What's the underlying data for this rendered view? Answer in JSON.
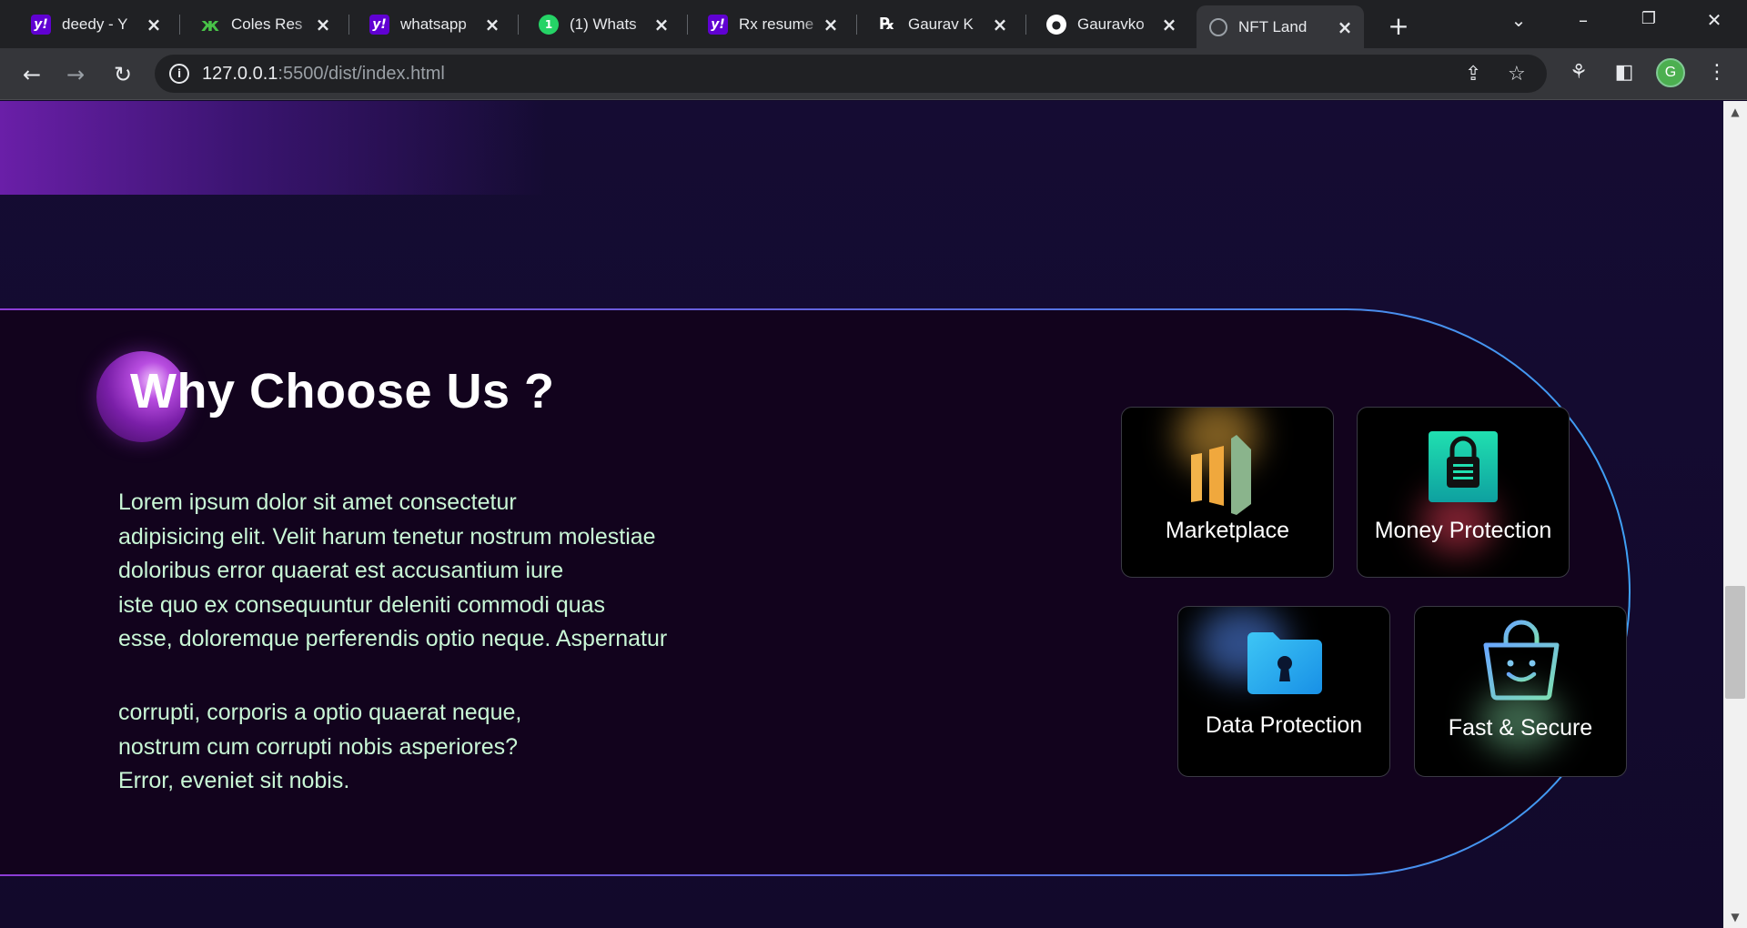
{
  "browser": {
    "tabs": [
      {
        "title": "deedy - Y",
        "favicon": "yahoo-icon"
      },
      {
        "title": "Coles Res",
        "favicon": "coles-icon"
      },
      {
        "title": "whatsapp",
        "favicon": "yahoo-icon"
      },
      {
        "title": "(1) Whats",
        "favicon": "whatsapp-icon"
      },
      {
        "title": "Rx resume",
        "favicon": "yahoo-icon"
      },
      {
        "title": "Gaurav K",
        "favicon": "rx-icon"
      },
      {
        "title": "Gauravko",
        "favicon": "github-icon"
      },
      {
        "title": "NFT Land",
        "favicon": "globe-icon",
        "active": true
      }
    ],
    "url_host": "127.0.0.1",
    "url_rest": ":5500/dist/index.html",
    "profile_initial": "G"
  },
  "section": {
    "heading": "Why Choose Us ?",
    "paragraph1": "Lorem ipsum dolor sit amet consectetur\nadipisicing elit. Velit harum tenetur nostrum molestiae\ndoloribus error quaerat est accusantium iure\niste quo ex consequuntur deleniti commodi quas\nesse, doloremque perferendis optio neque. Aspernatur",
    "paragraph2": "corrupti, corporis a optio quaerat neque,\nnostrum cum corrupti nobis asperiores?\nError, eveniet sit nobis.",
    "colors": {
      "text": "#c9f7d6",
      "border_start": "#8e3bd6",
      "border_end": "#3fa0f5"
    }
  },
  "features": [
    {
      "label": "Marketplace",
      "icon": "bar-chart-icon"
    },
    {
      "label": "Money Protection",
      "icon": "lock-clipboard-icon"
    },
    {
      "label": "Data Protection",
      "icon": "locked-folder-icon"
    },
    {
      "label": "Fast & Secure",
      "icon": "smiley-bag-icon"
    }
  ]
}
